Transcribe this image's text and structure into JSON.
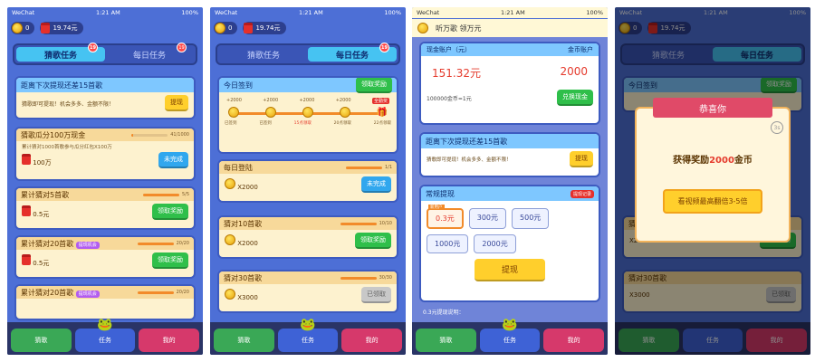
{
  "status": {
    "carrier": "WeChat",
    "time": "1:21 AM",
    "battery": "100%"
  },
  "balance": {
    "coins": "0",
    "cash": "19.74元"
  },
  "tabs": {
    "t1": "猜歌任务",
    "t2": "每日任务",
    "badge": "19"
  },
  "nav": {
    "n1": "猜歌",
    "n2": "任务",
    "n3": "我的"
  },
  "p1": {
    "top_title": "距离下次提现还差15首歌",
    "top_desc": "猜歌即可提现！机会多多、金额不限！",
    "top_btn": "提现",
    "c1_title": "猜歌瓜分100万现金",
    "c1_prog": "41/1000",
    "c1_desc": "累计猜对1000首歌参与瓜分红包X100万",
    "c1_reward": "100万",
    "c1_btn": "未完成",
    "c2_title": "累计猜对5首歌",
    "c2_prog": "5/5",
    "c2_reward": "0.5元",
    "c2_btn": "领取奖励",
    "c3_title": "累计猜对20首歌",
    "c3_tag": "提现机会",
    "c3_prog": "20/20",
    "c3_reward": "0.5元",
    "c3_btn": "领取奖励",
    "c4_title": "累计猜对20首歌",
    "c4_tag": "提现机会",
    "c4_prog": "20/20"
  },
  "p2": {
    "sign_title": "今日签到",
    "sign_btn": "领取奖励",
    "sign_points": [
      "+2000",
      "+2000",
      "+2000",
      "+2000",
      "全勤奖"
    ],
    "sign_days": [
      "已签到",
      "已签到",
      "15点领取",
      "20点领取",
      "22点领取"
    ],
    "d1_title": "每日登陆",
    "d1_prog": "1/1",
    "d1_reward": "X2000",
    "d1_btn": "未完成",
    "d2_title": "猜对10首歌",
    "d2_prog": "10/10",
    "d2_reward": "X2000",
    "d2_btn": "领取奖励",
    "d3_title": "猜对30首歌",
    "d3_prog": "30/30",
    "d3_reward": "X3000",
    "d3_btn": "已领取"
  },
  "p3": {
    "appbar": "听万歌  领万元",
    "cash_label": "现金账户（元）",
    "coin_label": "金币账户",
    "cash_val": "151.32元",
    "coin_val": "2000",
    "rate": "100000金币=1元",
    "exchange_btn": "兑换现金",
    "next_title": "距离下次提现还差15首歌",
    "next_desc": "猜歌即可提现！机会多多、金额不限！",
    "next_btn": "提现",
    "wd_title": "常规提现",
    "wd_record": "提现记录",
    "wd_new": "新用户",
    "amounts": [
      "0.3元",
      "300元",
      "500元",
      "1000元",
      "2000元"
    ],
    "wd_btn": "提现",
    "footer": "0.3元提现说明："
  },
  "p4": {
    "ribbon": "恭喜你",
    "countdown": "3s",
    "msg_pre": "获得奖励",
    "msg_amt": "2000",
    "msg_post": "金币",
    "btn": "看视频最高翻倍3-5倍"
  },
  "colors": {
    "accent": "#4d6fd6",
    "green": "#2fbf4a",
    "yellow": "#ffcf2c",
    "red": "#e53b2d"
  }
}
